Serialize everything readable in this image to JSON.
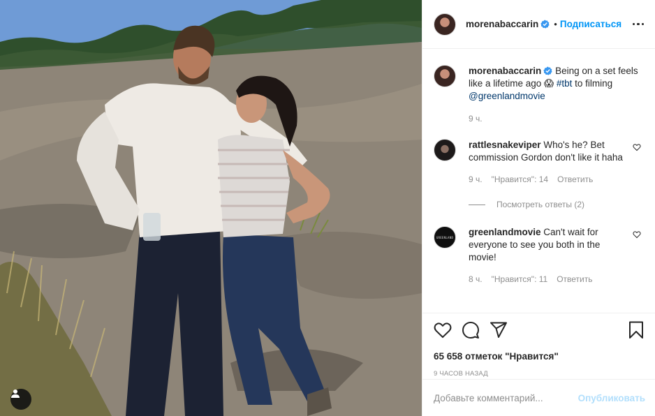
{
  "post": {
    "author": "morenabaccarin",
    "follow_label": "Подписаться",
    "separator": "•",
    "caption_prefix": "Being on a set feels like a lifetime ago 😱 ",
    "caption_hashtag": "#tbt",
    "caption_middle": " to filming ",
    "caption_mention": "@greenlandmovie",
    "caption_time": "9 ч.",
    "likes_label": "65 658 отметок \"Нравится\"",
    "posted_time": "9 часов назад"
  },
  "comments": [
    {
      "user": "rattlesnakeviper",
      "text": "Who's he? Bet commission Gordon don't like it haha",
      "time": "9 ч.",
      "likes": "\"Нравится\": 14",
      "reply_label": "Ответить",
      "view_replies": "Посмотреть ответы (2)"
    },
    {
      "user": "greenlandmovie",
      "avatar_text": "GREENLAND",
      "text": "Can't wait for everyone to see you both in the movie!",
      "time": "8 ч.",
      "likes": "\"Нравится\": 11",
      "reply_label": "Ответить"
    }
  ],
  "composer": {
    "placeholder": "Добавьте комментарий...",
    "publish_label": "Опубликовать"
  },
  "icons": {
    "like": "heart-icon",
    "comment": "comment-icon",
    "share": "paper-plane-icon",
    "save": "bookmark-icon",
    "options": "more-options-icon",
    "verified": "verified-badge-icon",
    "tags": "user-tag-icon"
  },
  "colors": {
    "link_blue": "#0095f6",
    "publish_disabled": "#b2dffc",
    "meta_gray": "#8e8e8e",
    "text": "#262626"
  }
}
